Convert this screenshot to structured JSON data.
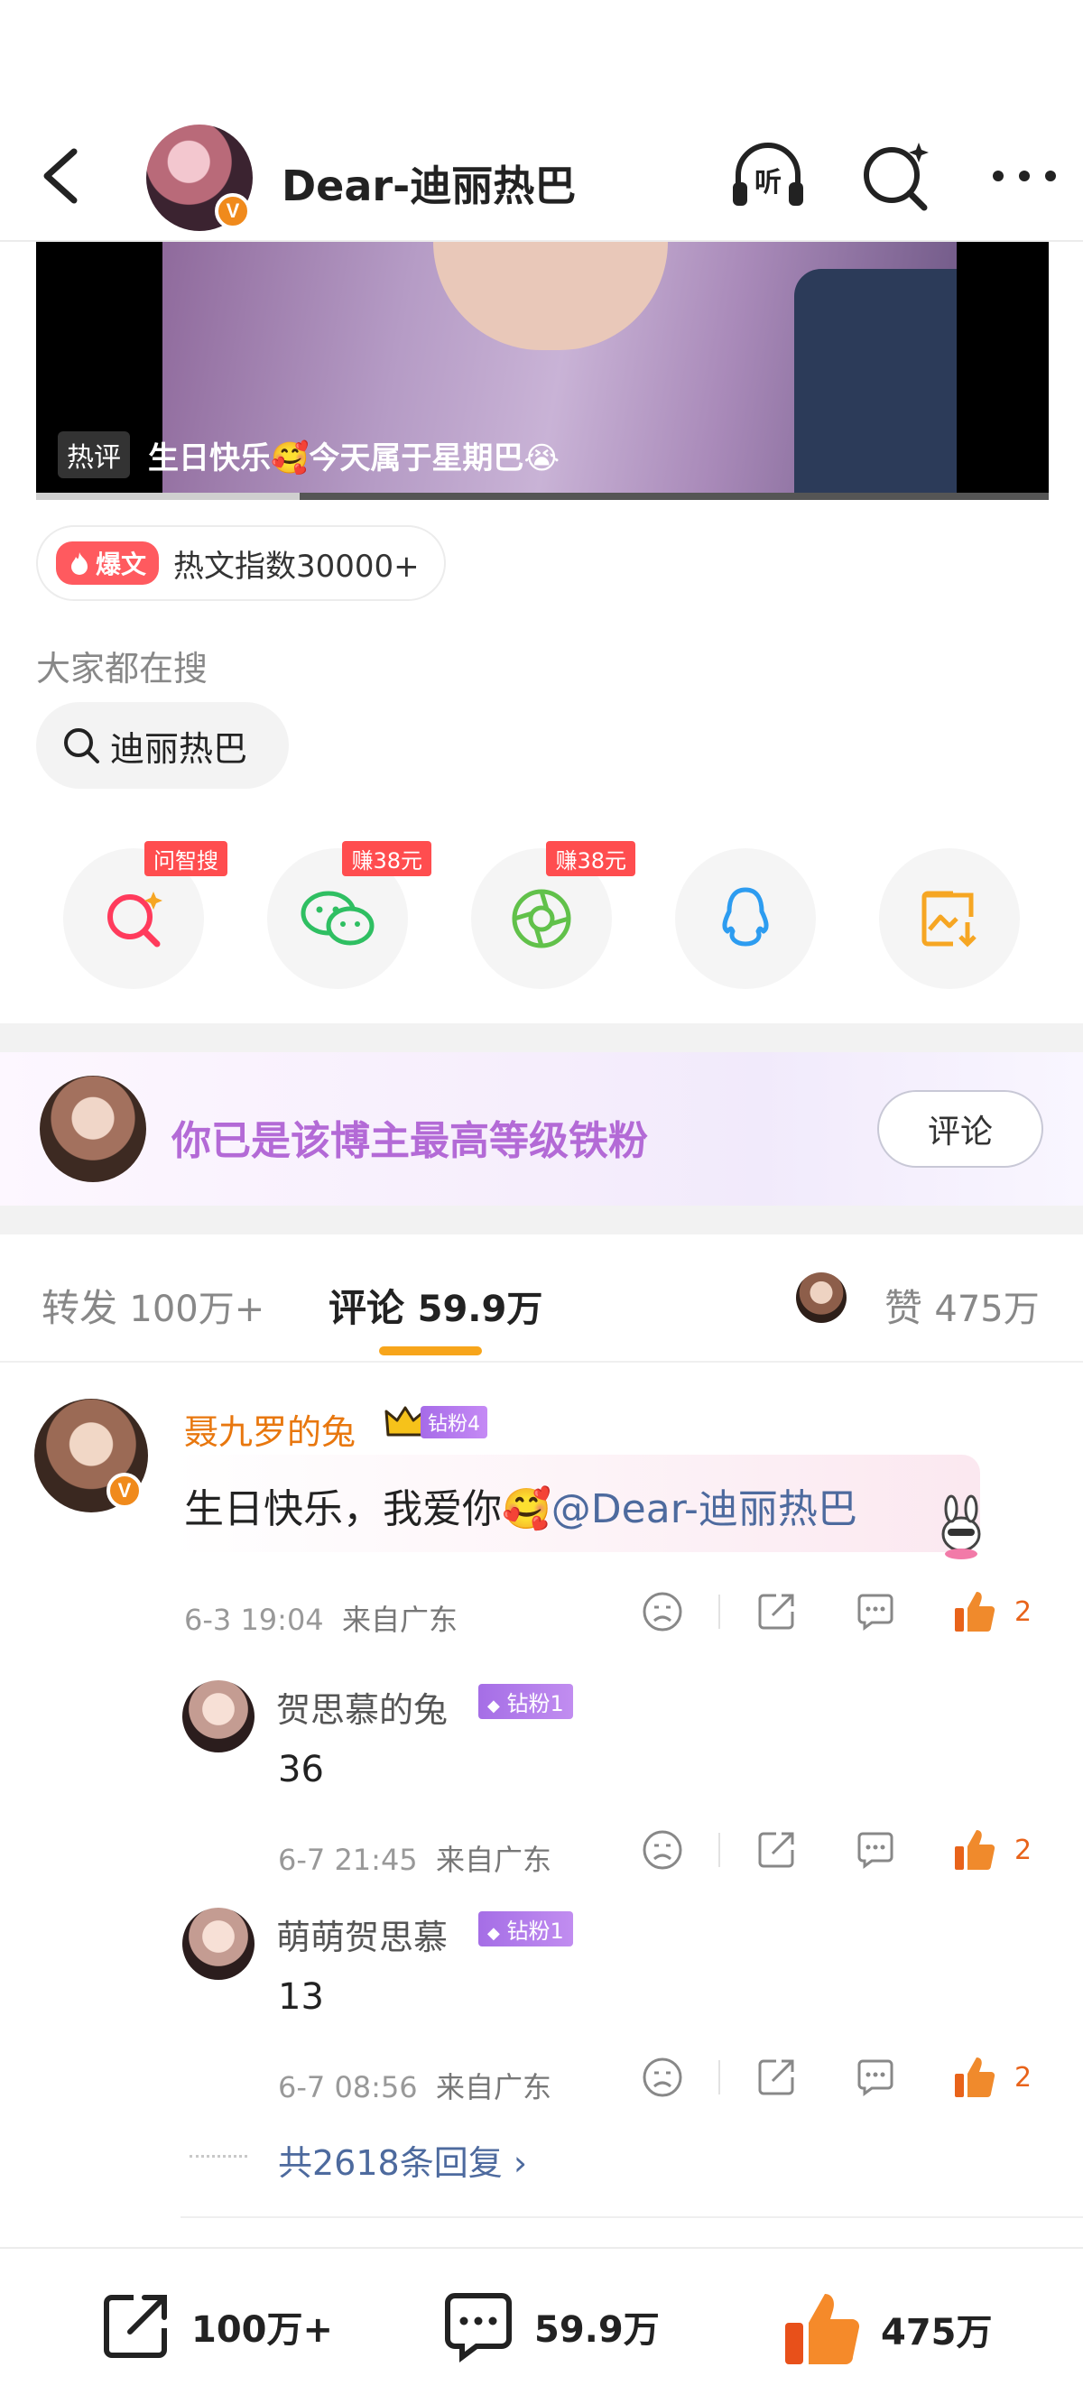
{
  "header": {
    "title": "Dear-迪丽热巴",
    "verified_badge": "V",
    "icons": [
      "back-icon",
      "listen-icon",
      "ai-search-icon",
      "more-icon"
    ],
    "listen_label": "听"
  },
  "video": {
    "tag": "热评",
    "caption": "生日快乐🥰今天属于星期巴😭",
    "progress_percent": 26
  },
  "hot_index": {
    "badge": "爆文",
    "text": "热文指数30000+"
  },
  "search": {
    "section_label": "大家都在搜",
    "chip": "迪丽热巴"
  },
  "share_targets": [
    {
      "name": "ask-search",
      "tag": "问智搜",
      "color": "#ff3b5c"
    },
    {
      "name": "wechat",
      "tag": "赚38元",
      "color": "#2fbf62"
    },
    {
      "name": "moments",
      "tag": "赚38元",
      "color": "#61c14a"
    },
    {
      "name": "qq",
      "tag": "",
      "color": "#2d9cf0"
    },
    {
      "name": "save-image",
      "tag": "",
      "color": "#f6a623"
    }
  ],
  "fan_banner": {
    "text": "你已是该博主最高等级铁粉",
    "button": "评论"
  },
  "tabs": {
    "repost_label": "转发",
    "repost_count": "100万+",
    "comment_label": "评论",
    "comment_count": "59.9万",
    "like_label": "赞",
    "like_count": "475万"
  },
  "comment": {
    "author": "聂九罗的兔",
    "fan_level": "钻粉4",
    "text_prefix": "生日快乐，我爱你🥰",
    "mention": "@Dear-迪丽热巴",
    "time": "6-3 19:04",
    "location": "来自广东",
    "likes": "2",
    "replies": [
      {
        "author": "贺思慕的兔",
        "fan_level": "钻粉1",
        "text": "36",
        "time": "6-7 21:45",
        "location": "来自广东",
        "likes": "2"
      },
      {
        "author": "萌萌贺思慕",
        "fan_level": "钻粉1",
        "text": "13",
        "time": "6-7 08:56",
        "location": "来自广东",
        "likes": "2"
      }
    ],
    "more_replies": "共2618条回复"
  },
  "bottom_bar": {
    "repost": "100万+",
    "comment": "59.9万",
    "like": "475万"
  },
  "colors": {
    "accent_orange": "#f7a51b",
    "name_orange": "#e8770e",
    "link_blue": "#4d6a9e",
    "fan_purple": "#b36ad6",
    "like_orange": "#e8631a"
  }
}
